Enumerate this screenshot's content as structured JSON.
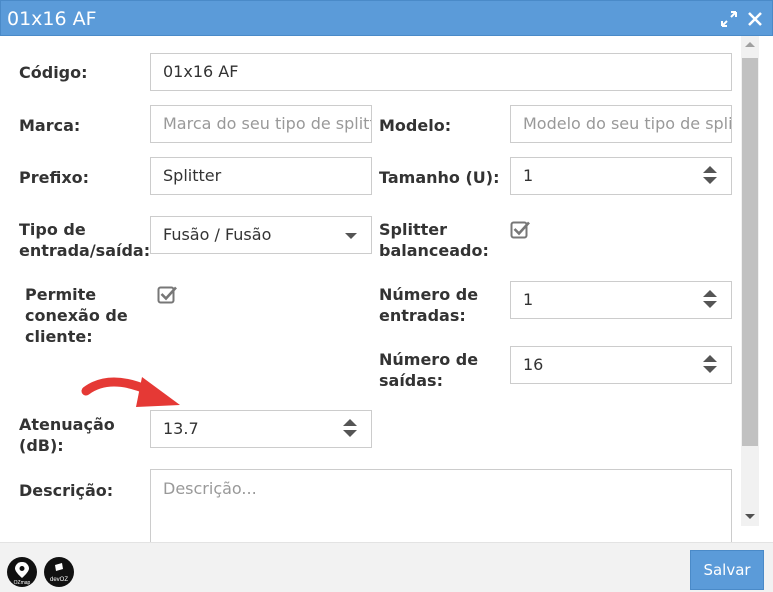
{
  "window": {
    "title": "01x16 AF"
  },
  "form": {
    "codigo": {
      "label": "Código:",
      "value": "01x16 AF"
    },
    "marca": {
      "label": "Marca:",
      "placeholder": "Marca do seu tipo de splitter"
    },
    "modelo": {
      "label": "Modelo:",
      "placeholder": "Modelo do seu tipo de splitter"
    },
    "prefixo": {
      "label": "Prefixo:",
      "value": "Splitter"
    },
    "tamanho": {
      "label": "Tamanho (U):",
      "value": "1"
    },
    "tipo": {
      "label_line1": "Tipo de",
      "label_line2": "entrada/saída:",
      "value": "Fusão / Fusão"
    },
    "balanceado": {
      "label_line1": "Splitter",
      "label_line2": "balanceado:",
      "checked": true
    },
    "permite": {
      "label_line1": "Permite",
      "label_line2": "conexão de",
      "label_line3": "cliente:",
      "checked": true
    },
    "entradas": {
      "label_line1": "Número de",
      "label_line2": "entradas:",
      "value": "1"
    },
    "saidas": {
      "label_line1": "Número de",
      "label_line2": "saídas:",
      "value": "16"
    },
    "atenuacao": {
      "label_line1": "Atenuação",
      "label_line2": "(dB):",
      "value": "13.7"
    },
    "descricao": {
      "label": "Descrição:",
      "placeholder": "Descrição..."
    }
  },
  "annotation": {
    "arrow_color": "#e53935"
  },
  "footer": {
    "save_label": "Salvar",
    "logo1_text": "OZmap",
    "logo2_text": "devOZ"
  },
  "colors": {
    "accent": "#5b9bd9"
  }
}
